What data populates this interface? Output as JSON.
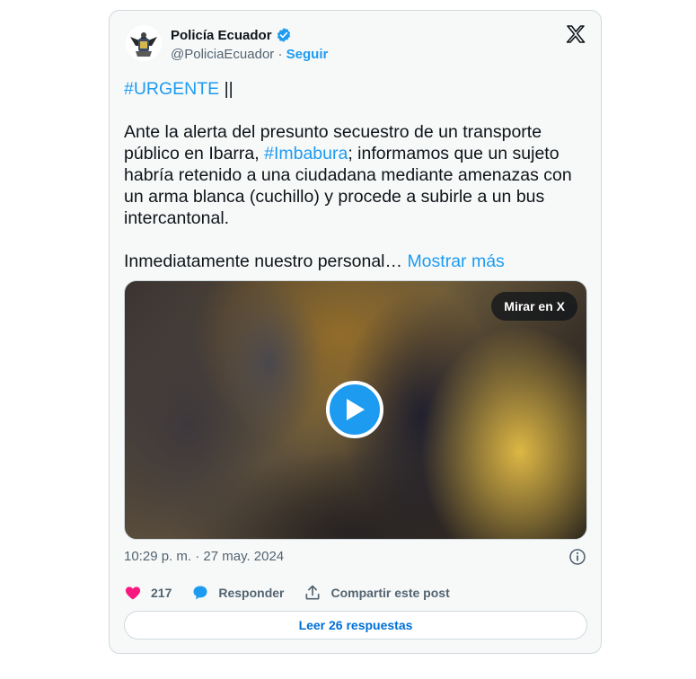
{
  "author": {
    "name": "Policía Ecuador",
    "handle": "@PoliciaEcuador",
    "separator": " · ",
    "follow_label": "Seguir"
  },
  "icons": {
    "avatar": "police-badge-icon",
    "verified": "verified-badge-icon",
    "logo": "x-logo-icon",
    "play": "play-icon",
    "info": "info-icon",
    "like": "heart-icon",
    "reply": "reply-bubble-icon",
    "share": "share-icon"
  },
  "tweet": {
    "hashtag_urgente": "#URGENTE",
    "after_urgente": " ||",
    "para1_start": "Ante la alerta del presunto secuestro de un transporte\npúblico en Ibarra, ",
    "hashtag_imbabura": "#Imbabura",
    "para1_end": "; informamos que un sujeto\nhabría retenido a una ciudadana mediante amenazas con\nun arma blanca (cuchillo) y procede a subirle a un bus\nintercantonal.",
    "para2": "Inmediatamente nuestro personal…",
    "show_more": "Mostrar más"
  },
  "media": {
    "watch_label": "Mirar en X"
  },
  "timestamp": "10:29 p. m. · 27 may. 2024",
  "actions": {
    "likes_count": "217",
    "reply_label": "Responder",
    "share_label": "Compartir este post"
  },
  "read_replies_label": "Leer 26 respuestas",
  "colors": {
    "accent": "#1d9bf0",
    "like": "#f91880",
    "card_bg": "#f7f9f9",
    "border": "#cfd9de",
    "secondary_text": "#536471"
  }
}
